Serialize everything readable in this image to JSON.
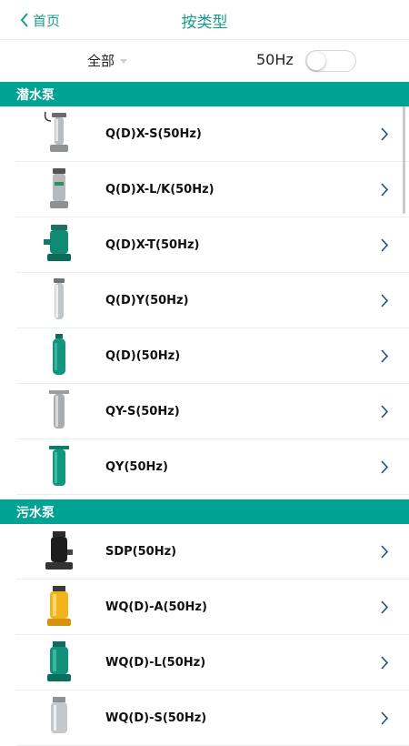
{
  "header": {
    "back_label": "首页",
    "title": "按类型"
  },
  "filter": {
    "category": "全部",
    "frequency_label": "50Hz",
    "frequency_toggle_on": false
  },
  "sections": [
    {
      "title": "潜水泵",
      "items": [
        "Q(D)X-S(50Hz)",
        "Q(D)X-L/K(50Hz)",
        "Q(D)X-T(50Hz)",
        "Q(D)Y(50Hz)",
        "Q(D)(50Hz)",
        "QY-S(50Hz)",
        "QY(50Hz)"
      ]
    },
    {
      "title": "污水泵",
      "items": [
        "SDP(50Hz)",
        "WQ(D)-A(50Hz)",
        "WQ(D)-L(50Hz)",
        "WQ(D)-S(50Hz)"
      ]
    }
  ],
  "colors": {
    "accent": "#00a294",
    "header_text": "#1a9a8c",
    "chevron": "#1f4f8a"
  },
  "icons": {
    "back": "chevron-left-icon",
    "row_arrow": "chevron-right-icon",
    "dropdown": "caret-down-icon"
  }
}
